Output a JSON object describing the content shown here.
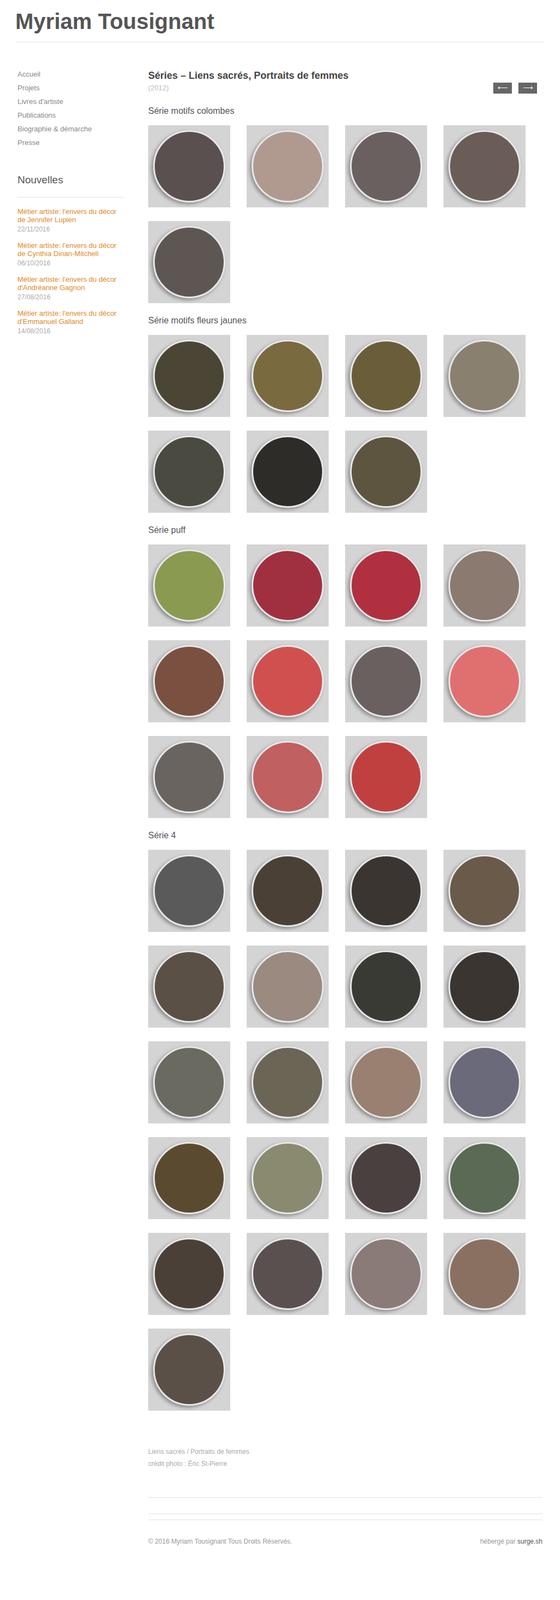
{
  "site": {
    "title": "Myriam Tousignant"
  },
  "nav": [
    "Accueil",
    "Projets",
    "Livres d'artiste",
    "Publications",
    "Biographie & démarche",
    "Presse"
  ],
  "news": {
    "heading": "Nouvelles",
    "items": [
      {
        "title": "Métier artiste: l'envers du décor de Jennifer Lupien",
        "date": "22/11/2016"
      },
      {
        "title": "Métier artiste: l'envers du décor de Cynthia Dinan-Mitchell",
        "date": "06/10/2016"
      },
      {
        "title": "Métier artiste: l'envers du décor d'Andréanne Gagnon",
        "date": "27/08/2016"
      },
      {
        "title": "Métier artiste: l'envers du décor d'Emmanuel Galland",
        "date": "14/08/2016"
      }
    ]
  },
  "page": {
    "title": "Séries – Liens sacrés, Portraits de femmes",
    "year": "(2012)",
    "arrows": [
      "⟵",
      "⟶"
    ]
  },
  "series": [
    {
      "title": "Série motifs colombes",
      "images": [
        {
          "color": "#5a5050"
        },
        {
          "color": "#b09a90"
        },
        {
          "color": "#6a6060"
        },
        {
          "color": "#6a5d58"
        },
        {
          "color": "#5e5652"
        }
      ]
    },
    {
      "title": "Série motifs fleurs jaunes",
      "images": [
        {
          "color": "#4a4535"
        },
        {
          "color": "#7a6a40"
        },
        {
          "color": "#6a5e3a"
        },
        {
          "color": "#8a8070"
        },
        {
          "color": "#4a4a40"
        },
        {
          "color": "#2e2c28"
        },
        {
          "color": "#5e5540"
        }
      ]
    },
    {
      "title": "Série puff",
      "images": [
        {
          "color": "#8a9a50"
        },
        {
          "color": "#a03040"
        },
        {
          "color": "#b03040"
        },
        {
          "color": "#8a7a70"
        },
        {
          "color": "#7a5040"
        },
        {
          "color": "#d05050"
        },
        {
          "color": "#6a6060"
        },
        {
          "color": "#e07070"
        },
        {
          "color": "#6a6460"
        },
        {
          "color": "#c06060"
        },
        {
          "color": "#c04040"
        }
      ]
    },
    {
      "title": "Série 4",
      "images": [
        {
          "color": "#5a5a5a"
        },
        {
          "color": "#4a4035"
        },
        {
          "color": "#3a3530"
        },
        {
          "color": "#6a5a4a"
        },
        {
          "color": "#5a5045"
        },
        {
          "color": "#9a8a80"
        },
        {
          "color": "#3a3a35"
        },
        {
          "color": "#3a3530"
        },
        {
          "color": "#6a6a60"
        },
        {
          "color": "#6a6555"
        },
        {
          "color": "#9a8070"
        },
        {
          "color": "#6a6a7a"
        },
        {
          "color": "#5a4a30"
        },
        {
          "color": "#8a8a70"
        },
        {
          "color": "#4a4040"
        },
        {
          "color": "#5a6a55"
        },
        {
          "color": "#4a4038"
        },
        {
          "color": "#5a5050"
        },
        {
          "color": "#8a7a78"
        },
        {
          "color": "#8a7060"
        },
        {
          "color": "#5a5048"
        }
      ]
    }
  ],
  "caption": [
    "Liens sacrés / Portraits de femmes",
    "crédit photo : Éric St-Pierre"
  ],
  "footer": {
    "copyright": "© 2016 Myriam Tousignant Tous Droits Réservés.",
    "hosted": "hébergé par",
    "host": "surge.sh"
  }
}
